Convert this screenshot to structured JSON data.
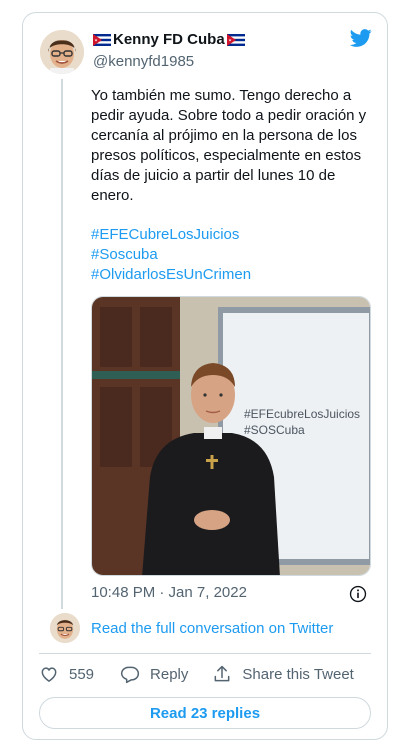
{
  "tweet": {
    "author_name": "Kenny FD Cuba",
    "author_handle": "@kennyfd1985",
    "text": "Yo también me sumo. Tengo derecho a pedir ayuda. Sobre todo a pedir oración y cercanía al prójimo en la persona de los presos políticos, especialmente en estos días de juicio a partir del lunes 10 de enero.",
    "hashtags": [
      "#EFECubreLosJuicios",
      "#Soscuba",
      "#OlvidarlosEsUnCrimen"
    ],
    "media": {
      "whiteboard_lines": [
        "#EFEcubreLosJuicios",
        "#SOSCuba"
      ]
    },
    "timestamp": "10:48 PM · Jan 7, 2022"
  },
  "conversation_link": "Read the full conversation on Twitter",
  "actions": {
    "like_count": "559",
    "reply_label": "Reply",
    "share_label": "Share this Tweet"
  },
  "read_replies_label": "Read 23 replies",
  "colors": {
    "link_blue": "#1d9bf0",
    "secondary_text": "#536471",
    "border": "#cfd9de"
  }
}
